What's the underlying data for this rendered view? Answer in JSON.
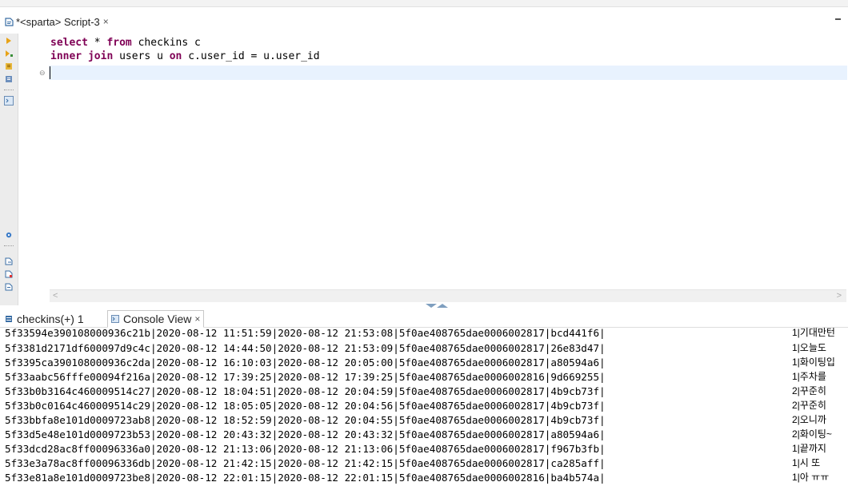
{
  "editor": {
    "tab_label": "*<sparta> Script-3",
    "close_glyph": "×",
    "code": [
      {
        "kw1": "select",
        "t1": " * ",
        "kw2": "from",
        "t2": " checkins c"
      },
      {
        "kw1": "inner join",
        "t1": " users u ",
        "kw2": "on",
        "t2": " c.user_id = u.user_id"
      }
    ]
  },
  "results": {
    "tabs": [
      {
        "label": "checkins(+) 1"
      },
      {
        "label": "Console View"
      }
    ],
    "close_glyph": "×"
  },
  "console": {
    "rows": [
      {
        "text": "5f33594e390108000936c21b|2020-08-12 11:51:59|2020-08-12 21:53:08|5f0ae408765dae0006002817|bcd441f6|",
        "tail": "1|기대만턴"
      },
      {
        "text": "5f3381d2171df600097d9c4c|2020-08-12 14:44:50|2020-08-12 21:53:09|5f0ae408765dae0006002817|26e83d47|",
        "tail": "1|오늘도"
      },
      {
        "text": "5f3395ca390108000936c2da|2020-08-12 16:10:03|2020-08-12 20:05:00|5f0ae408765dae0006002817|a80594a6|",
        "tail": "1|화이팅입"
      },
      {
        "text": "5f33aabc56fffe00094f216a|2020-08-12 17:39:25|2020-08-12 17:39:25|5f0ae408765dae0006002816|9d669255|",
        "tail": "1|주차를"
      },
      {
        "text": "5f33b0b3164c460009514c27|2020-08-12 18:04:51|2020-08-12 20:04:59|5f0ae408765dae0006002817|4b9cb73f|",
        "tail": "2|꾸준히"
      },
      {
        "text": "5f33b0c0164c460009514c29|2020-08-12 18:05:05|2020-08-12 20:04:56|5f0ae408765dae0006002817|4b9cb73f|",
        "tail": "2|꾸준히"
      },
      {
        "text": "5f33bbfa8e101d0009723ab8|2020-08-12 18:52:59|2020-08-12 20:04:55|5f0ae408765dae0006002817|4b9cb73f|",
        "tail": "2|오니까"
      },
      {
        "text": "5f33d5e48e101d0009723b53|2020-08-12 20:43:32|2020-08-12 20:43:32|5f0ae408765dae0006002817|a80594a6|",
        "tail": "2|화이팅~"
      },
      {
        "text": "5f33dcd28ac8ff00096336a0|2020-08-12 21:13:06|2020-08-12 21:13:06|5f0ae408765dae0006002817|f967b3fb|",
        "tail": "1|끝까지"
      },
      {
        "text": "5f33e3a78ac8ff00096336db|2020-08-12 21:42:15|2020-08-12 21:42:15|5f0ae408765dae0006002817|ca285aff|",
        "tail": "1|시 또"
      },
      {
        "text": "5f33e81a8e101d0009723be8|2020-08-12 22:01:15|2020-08-12 22:01:15|5f0ae408765dae0006002816|ba4b574a|",
        "tail": "1|아 ㅠㅠ"
      }
    ]
  }
}
